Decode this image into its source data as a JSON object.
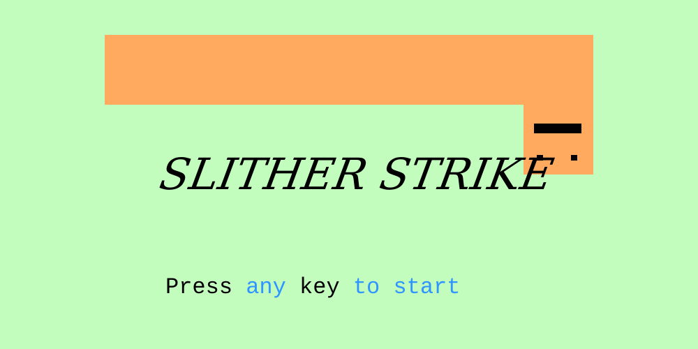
{
  "game": {
    "title": "SLITHER STRIKE",
    "prompt": {
      "press": "Press",
      "any": "any",
      "key": "key",
      "to_start": "to start"
    }
  },
  "colors": {
    "background": "#c3fdbe",
    "snake": "#ffaa5e",
    "snake_face": "#000000",
    "text": "#000000",
    "accent": "#2f95ff"
  },
  "icons": {
    "snake": "snake-icon",
    "eye": "eye-icon",
    "mouth": "mouth-icon"
  }
}
